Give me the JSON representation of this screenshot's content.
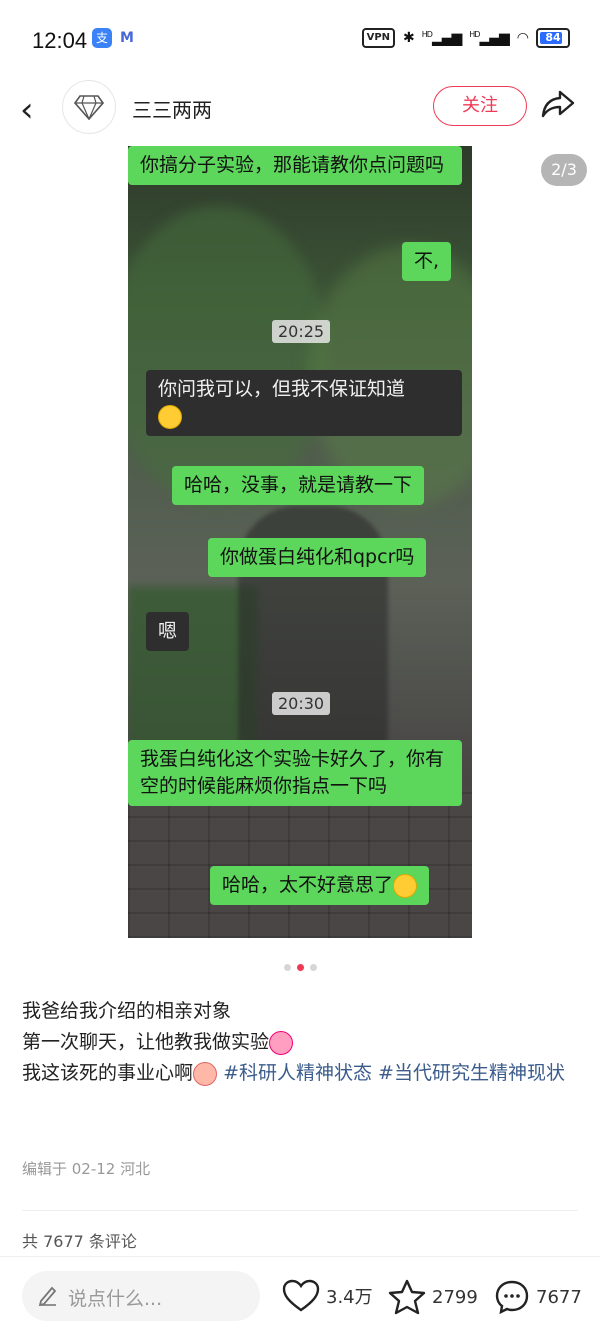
{
  "status_bar": {
    "time": "12:04",
    "app_badge": "支",
    "m_badge": "M",
    "vpn": "VPN",
    "signal1": "HD",
    "signal2": "HD",
    "battery": "84",
    "battery_level": 0.84
  },
  "header": {
    "username": "三三两两",
    "follow_label": "关注"
  },
  "image": {
    "page_indicator": "2/3",
    "messages": [
      {
        "side": "right",
        "style": "green",
        "text": "你搞分子实验，那能请教你点问题吗"
      },
      {
        "side": "right",
        "style": "green",
        "text": "不,"
      },
      {
        "side": "center",
        "style": "timestamp",
        "text": "20:25"
      },
      {
        "side": "left",
        "style": "dark",
        "text": "你问我可以，但我不保证知道"
      },
      {
        "side": "right",
        "style": "green",
        "text": "哈哈，没事，就是请教一下"
      },
      {
        "side": "right",
        "style": "green",
        "text": "你做蛋白纯化和qpcr吗"
      },
      {
        "side": "left",
        "style": "dark",
        "text": "嗯"
      },
      {
        "side": "center",
        "style": "timestamp",
        "text": "20:30"
      },
      {
        "side": "right",
        "style": "green",
        "text": "我蛋白纯化这个实验卡好久了，你有空的时候能麻烦你指点一下吗"
      },
      {
        "side": "right",
        "style": "green",
        "text": "哈哈，太不好意思了"
      }
    ]
  },
  "caption": {
    "line1": "我爸给我介绍的相亲对象",
    "line2": "第一次聊天，让他教我做实验",
    "line3_prefix": "我这该死的事业心啊",
    "tag1": "#科研人精神状态",
    "tag2": "#当代研究生精神现状"
  },
  "meta": "编辑于 02-12 河北",
  "comments_count": "共 7677 条评论",
  "bottom_bar": {
    "input_placeholder": "说点什么...",
    "likes": "3.4万",
    "stars": "2799",
    "comments": "7677"
  },
  "colors": {
    "accent": "#f03a55",
    "chat_green": "#5cd65b",
    "tag_blue": "#3b5c8c"
  }
}
